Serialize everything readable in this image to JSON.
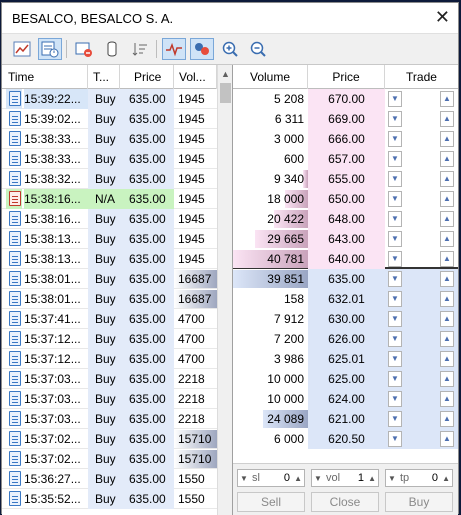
{
  "window": {
    "title": "BESALCO, BESALCO S. A.",
    "close_glyph": "✕"
  },
  "toolbar": {
    "icons": [
      "chart-icon",
      "time-sales-icon",
      "remove-icon",
      "cylinder-icon",
      "sort-icon",
      "tick-chart-icon",
      "color-mode-icon",
      "zoom-in-icon",
      "zoom-out-icon"
    ]
  },
  "left_table": {
    "headers": [
      "Time",
      "T...",
      "Price",
      "Vol..."
    ],
    "rows": [
      {
        "time": "15:39:22...",
        "type": "Buy",
        "price": "635.00",
        "vol": "1945",
        "volbar": 0
      },
      {
        "time": "15:39:02...",
        "type": "Buy",
        "price": "635.00",
        "vol": "1945",
        "volbar": 0
      },
      {
        "time": "15:38:33...",
        "type": "Buy",
        "price": "635.00",
        "vol": "1945",
        "volbar": 0
      },
      {
        "time": "15:38:33...",
        "type": "Buy",
        "price": "635.00",
        "vol": "1945",
        "volbar": 0
      },
      {
        "time": "15:38:32...",
        "type": "Buy",
        "price": "635.00",
        "vol": "1945",
        "volbar": 0
      },
      {
        "time": "15:38:16...",
        "type": "N/A",
        "price": "635.00",
        "vol": "1945",
        "volbar": 0,
        "na": true
      },
      {
        "time": "15:38:16...",
        "type": "Buy",
        "price": "635.00",
        "vol": "1945",
        "volbar": 0
      },
      {
        "time": "15:38:13...",
        "type": "Buy",
        "price": "635.00",
        "vol": "1945",
        "volbar": 0
      },
      {
        "time": "15:38:13...",
        "type": "Buy",
        "price": "635.00",
        "vol": "1945",
        "volbar": 0
      },
      {
        "time": "15:38:01...",
        "type": "Buy",
        "price": "635.00",
        "vol": "16687",
        "volbar": 1
      },
      {
        "time": "15:38:01...",
        "type": "Buy",
        "price": "635.00",
        "vol": "16687",
        "volbar": 1
      },
      {
        "time": "15:37:41...",
        "type": "Buy",
        "price": "635.00",
        "vol": "4700",
        "volbar": 0
      },
      {
        "time": "15:37:12...",
        "type": "Buy",
        "price": "635.00",
        "vol": "4700",
        "volbar": 0
      },
      {
        "time": "15:37:12...",
        "type": "Buy",
        "price": "635.00",
        "vol": "4700",
        "volbar": 0
      },
      {
        "time": "15:37:03...",
        "type": "Buy",
        "price": "635.00",
        "vol": "2218",
        "volbar": 0
      },
      {
        "time": "15:37:03...",
        "type": "Buy",
        "price": "635.00",
        "vol": "2218",
        "volbar": 0
      },
      {
        "time": "15:37:03...",
        "type": "Buy",
        "price": "635.00",
        "vol": "2218",
        "volbar": 0
      },
      {
        "time": "15:37:02...",
        "type": "Buy",
        "price": "635.00",
        "vol": "15710",
        "volbar": 1
      },
      {
        "time": "15:37:02...",
        "type": "Buy",
        "price": "635.00",
        "vol": "15710",
        "volbar": 1
      },
      {
        "time": "15:36:27...",
        "type": "Buy",
        "price": "635.00",
        "vol": "1550",
        "volbar": 0
      },
      {
        "time": "15:35:52...",
        "type": "Buy",
        "price": "635.00",
        "vol": "1550",
        "volbar": 0
      }
    ]
  },
  "depth": {
    "headers": [
      "Volume",
      "Price",
      "Trade"
    ],
    "rows": [
      {
        "volume": "5 208",
        "price": "670.00",
        "side": "ask",
        "share": 0
      },
      {
        "volume": "6 311",
        "price": "669.00",
        "side": "ask",
        "share": 0
      },
      {
        "volume": "3 000",
        "price": "666.00",
        "side": "ask",
        "share": 0
      },
      {
        "volume": "600",
        "price": "657.00",
        "side": "ask",
        "share": 0
      },
      {
        "volume": "9 340",
        "price": "655.00",
        "side": "ask",
        "share": 0.07
      },
      {
        "volume": "18 000",
        "price": "650.00",
        "side": "ask",
        "share": 0.3
      },
      {
        "volume": "20 422",
        "price": "648.00",
        "side": "ask",
        "share": 0.45
      },
      {
        "volume": "29 665",
        "price": "643.00",
        "side": "ask",
        "share": 0.7
      },
      {
        "volume": "40 781",
        "price": "640.00",
        "side": "ask",
        "share": 1.0
      },
      {
        "volume": "39 851",
        "price": "635.00",
        "side": "bid",
        "share": 1.0
      },
      {
        "volume": "158",
        "price": "632.01",
        "side": "bid",
        "share": 0
      },
      {
        "volume": "7 912",
        "price": "630.00",
        "side": "bid",
        "share": 0
      },
      {
        "volume": "7 200",
        "price": "626.00",
        "side": "bid",
        "share": 0
      },
      {
        "volume": "3 986",
        "price": "625.01",
        "side": "bid",
        "share": 0
      },
      {
        "volume": "10 000",
        "price": "625.00",
        "side": "bid",
        "share": 0
      },
      {
        "volume": "10 000",
        "price": "624.00",
        "side": "bid",
        "share": 0
      },
      {
        "volume": "24 089",
        "price": "621.00",
        "side": "bid",
        "share": 0.6
      },
      {
        "volume": "6 000",
        "price": "620.50",
        "side": "bid",
        "share": 0
      }
    ]
  },
  "order": {
    "sl_label": "sl",
    "sl_value": "0",
    "vol_label": "vol",
    "vol_value": "1",
    "tp_label": "tp",
    "tp_value": "0",
    "sell_label": "Sell",
    "close_label": "Close",
    "buy_label": "Buy"
  }
}
